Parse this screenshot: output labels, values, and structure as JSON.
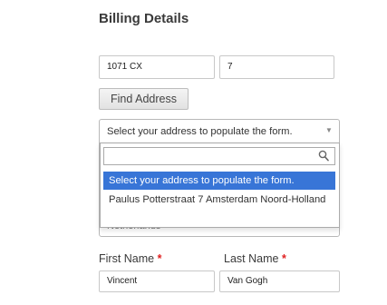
{
  "section": {
    "title": "Billing Details"
  },
  "postcode": {
    "value": "1071 CX"
  },
  "house_number": {
    "value": "7"
  },
  "find_address": {
    "label": "Find Address"
  },
  "address_select": {
    "selected": "Select your address to populate the form.",
    "search_value": "",
    "options": [
      "Select your address to populate the form.",
      "Paulus Potterstraat 7 Amsterdam Noord-Holland"
    ],
    "partially_hidden_field_value": "Netherlands"
  },
  "first_name": {
    "label": "First Name",
    "required_mark": "*",
    "value": "Vincent"
  },
  "last_name": {
    "label": "Last Name",
    "required_mark": "*",
    "value": "Van Gogh"
  },
  "colors": {
    "highlight": "#3875d7",
    "required": "#e02020"
  }
}
